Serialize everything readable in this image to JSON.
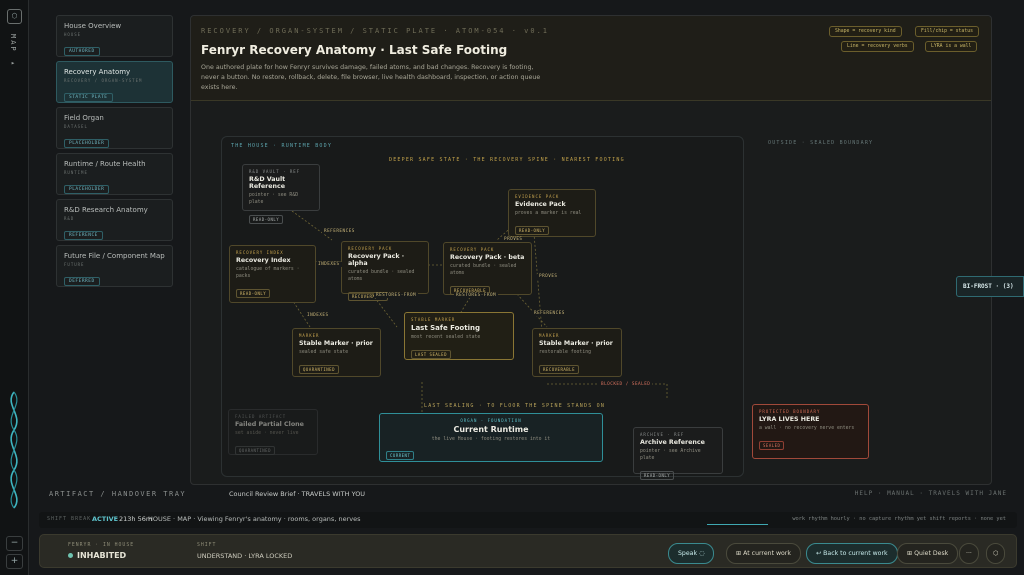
{
  "rail": {
    "map_label": "MAP ▸",
    "minus": "−",
    "plus": "+"
  },
  "sidebar": {
    "items": [
      {
        "title": "House Overview",
        "sub": "HOUSE",
        "badge": "AUTHORED"
      },
      {
        "title": "Recovery Anatomy",
        "sub": "RECOVERY / ORGAN-SYSTEM",
        "badge": "STATIC PLATE"
      },
      {
        "title": "Field Organ",
        "sub": "DATASEL",
        "badge": "PLACEHOLDER"
      },
      {
        "title": "Runtime / Route Health",
        "sub": "RUNTIME",
        "badge": "PLACEHOLDER"
      },
      {
        "title": "R&D Research Anatomy",
        "sub": "R&D",
        "badge": "REFERENCE"
      },
      {
        "title": "Future File / Component Map",
        "sub": "FUTURE",
        "badge": "DEFERRED"
      }
    ]
  },
  "header": {
    "crumb": "RECOVERY / ORGAN-SYSTEM / STATIC PLATE · ATOM-054 · v0.1",
    "title": "Fenryr Recovery Anatomy · Last Safe Footing",
    "desc": "One authored plate for how Fenryr survives damage, failed atoms, and bad changes. Recovery is footing, never a button. No restore, rollback, delete, file browser, live health dashboard, inspection, or action queue exists here.",
    "legend": [
      "Shape = recovery kind",
      "Fill/chip = status",
      "Line = recovery verbs",
      "LYRA is a wall"
    ]
  },
  "plate": {
    "label_house": "THE HOUSE · RUNTIME BODY",
    "label_outside": "OUTSIDE · SEALED BOUNDARY",
    "spine": "DEEPER SAFE STATE · THE RECOVERY SPINE · NEAREST FOOTING",
    "bottom_note": "LAST SEALING · TO FLOOR THE SPINE STANDS ON",
    "nodes": {
      "vault": {
        "kind": "R&D VAULT · REF",
        "name": "R&D Vault Reference",
        "desc": "pointer · see R&D plate",
        "tag": "READ-ONLY"
      },
      "evidence": {
        "kind": "EVIDENCE PACK",
        "name": "Evidence Pack",
        "desc": "proves a marker is real",
        "tag": "READ-ONLY"
      },
      "index": {
        "kind": "RECOVERY INDEX",
        "name": "Recovery Index",
        "desc": "catalogue of markers · packs",
        "tag": "READ-ONLY"
      },
      "alpha": {
        "kind": "RECOVERY PACK",
        "name": "Recovery Pack · alpha",
        "desc": "curated bundle · sealed atoms",
        "tag": "RECOVERABLE"
      },
      "beta": {
        "kind": "RECOVERY PACK",
        "name": "Recovery Pack · beta",
        "desc": "curated bundle · sealed atoms",
        "tag": "RECOVERABLE"
      },
      "prior_q": {
        "kind": "MARKER",
        "name": "Stable Marker · prior",
        "desc": "sealed safe state",
        "tag": "QUARANTINED"
      },
      "footing": {
        "kind": "STABLE MARKER",
        "name": "Last Safe Footing",
        "desc": "most recent sealed state",
        "tag": "LAST SEALED"
      },
      "prior_r": {
        "kind": "MARKER",
        "name": "Stable Marker · prior",
        "desc": "restorable footing",
        "tag": "RECOVERABLE"
      },
      "failed": {
        "kind": "FAILED ARTIFACT",
        "name": "Failed Partial Clone",
        "desc": "set aside · never live",
        "tag": "QUARANTINED"
      },
      "runtime": {
        "kind": "ORGAN · FOUNDATION",
        "name": "Current Runtime",
        "desc": "the live House · footing restores into it",
        "tag": "CURRENT"
      },
      "archive": {
        "kind": "ARCHIVE · REF",
        "name": "Archive Reference",
        "desc": "pointer · see Archive plate",
        "tag": "READ-ONLY"
      },
      "lyra": {
        "kind": "PROTECTED BOUNDARY",
        "name": "LYRA LIVES HERE",
        "desc": "a wall · no recovery nerve enters",
        "tag": "SEALED"
      }
    },
    "edges": {
      "references_1": "REFERENCES",
      "proves": "PROVES",
      "indexes_1": "INDEXES",
      "restores_from_1": "RESTORES-FROM",
      "restores_from_2": "RESTORES-FROM",
      "proves_2": "PROVES",
      "references_2": "REFERENCES",
      "indexes_2": "INDEXES",
      "blocked": "BLOCKED / SEALED"
    }
  },
  "bifrost": "BI-FROST · (3)",
  "tray": {
    "label": "ARTIFACT / HANDOVER TRAY",
    "content": "Council Review Brief · TRAVELS WITH YOU",
    "help": "HELP · MANUAL · TRAVELS WITH JANE"
  },
  "shiftbar": {
    "label": "SHIFT BREAK",
    "active": "ACTIVE",
    "time": "213h 56m",
    "context": "HOUSE · MAP · Viewing Fenryr's anatomy · rooms, organs, nerves",
    "trail": "work rhythm  hourly · no capture rhythm yet  shift reports · none yet"
  },
  "footer": {
    "glyph_label": "FENRYR · IN HOUSE",
    "state": "INHABITED",
    "shift_label": "SHIFT",
    "shift_value": "UNDERSTAND · LYRA LOCKED",
    "buttons": {
      "speak": "Speak",
      "at_work": "At current work",
      "back": "↩ Back to current work",
      "quiet": "Quiet Desk",
      "more": "···"
    }
  },
  "colors": {
    "accent": "#5ec3cc",
    "gold": "#c4a24e",
    "alert": "#d26a55"
  }
}
